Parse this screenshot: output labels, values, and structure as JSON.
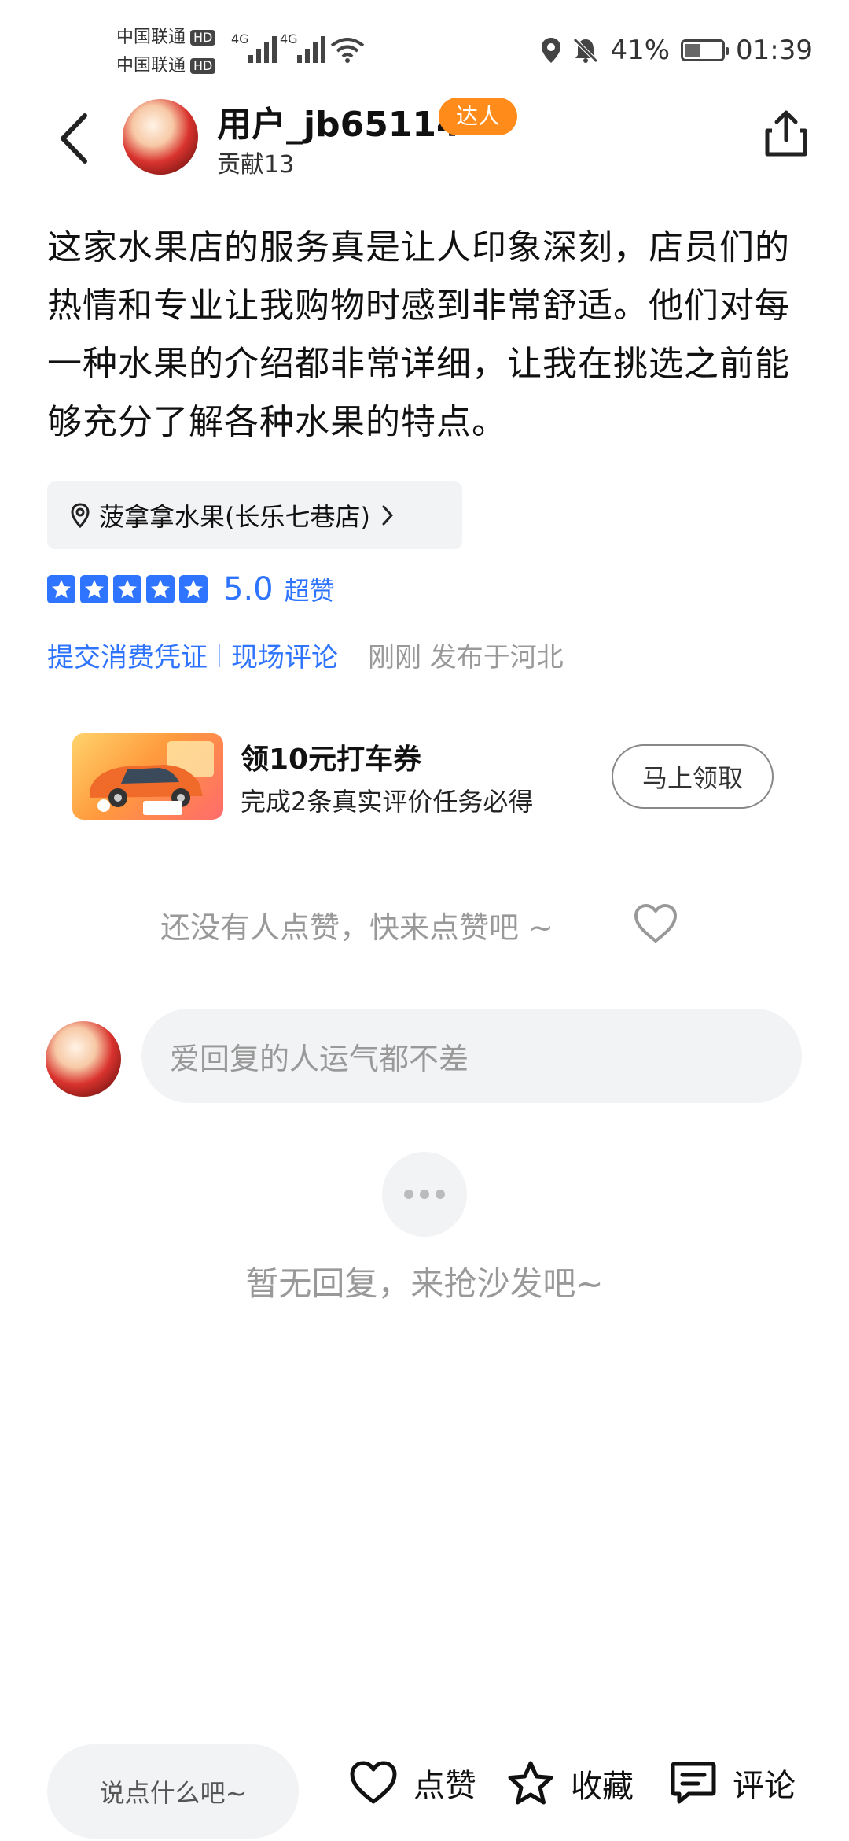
{
  "status_bar": {
    "carrier1": "中国联通",
    "carrier2": "中国联通",
    "hd": "HD",
    "net1": "4G",
    "net2": "4G",
    "battery_pct": "41%",
    "battery_level": 0.41,
    "time": "01:39"
  },
  "header": {
    "username": "用户_jb65114",
    "badge": "达人",
    "contribution": "贡献13"
  },
  "review": {
    "text": "这家水果店的服务真是让人印象深刻，店员们的热情和专业让我购物时感到非常舒适。他们对每一种水果的介绍都非常详细，让我在挑选之前能够充分了解各种水果的特点。",
    "shop": "菠拿拿水果(长乐七巷店)",
    "stars": 5,
    "score": "5.0",
    "score_label": "超赞",
    "link1": "提交消费凭证",
    "link2": "现场评论",
    "meta": "刚刚 发布于河北"
  },
  "coupon": {
    "title": "领10元打车券",
    "subtitle": "完成2条真实评价任务必得",
    "button": "马上领取"
  },
  "likes": {
    "prompt": "还没有人点赞，快来点赞吧 ~"
  },
  "reply": {
    "placeholder": "爱回复的人运气都不差",
    "empty_text": "暂无回复，来抢沙发吧~"
  },
  "bottom_bar": {
    "comment_placeholder": "说点什么吧~",
    "like_label": "点赞",
    "fav_label": "收藏",
    "comment_label": "评论"
  },
  "colors": {
    "accent": "#2f74ff",
    "badge": "#ff8c1a"
  }
}
